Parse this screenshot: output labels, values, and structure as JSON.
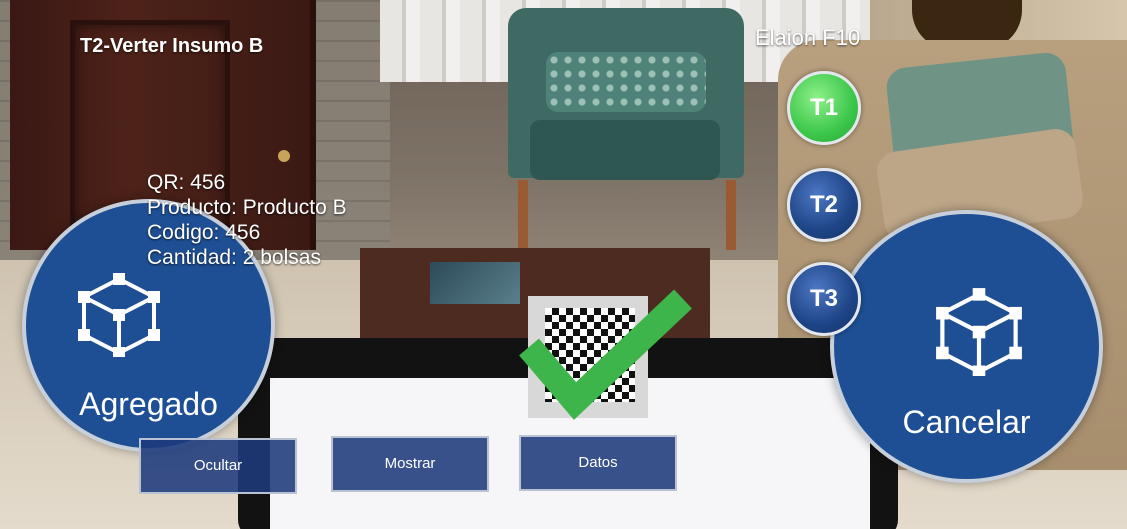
{
  "header": {
    "title": "T2-Verter Insumo B",
    "device": "Elaion F10"
  },
  "info": {
    "qr": "QR: 456",
    "producto": "Producto: Producto B",
    "codigo": "Codigo: 456",
    "cantidad": "Cantidad: 2 bolsas"
  },
  "actions": {
    "agregado_label": "Agregado",
    "cancelar_label": "Cancelar"
  },
  "tasks": [
    {
      "label": "T1",
      "state": "active",
      "color": "#3cc74a"
    },
    {
      "label": "T2",
      "state": "inactive",
      "color": "#1d4485"
    },
    {
      "label": "T3",
      "state": "inactive",
      "color": "#1d4485"
    }
  ],
  "toolbar": {
    "ocultar_label": "Ocultar",
    "mostrar_label": "Mostrar",
    "datos_label": "Datos"
  },
  "colors": {
    "primary_blue": "#1e4f94",
    "check_green": "#3eb54a"
  }
}
